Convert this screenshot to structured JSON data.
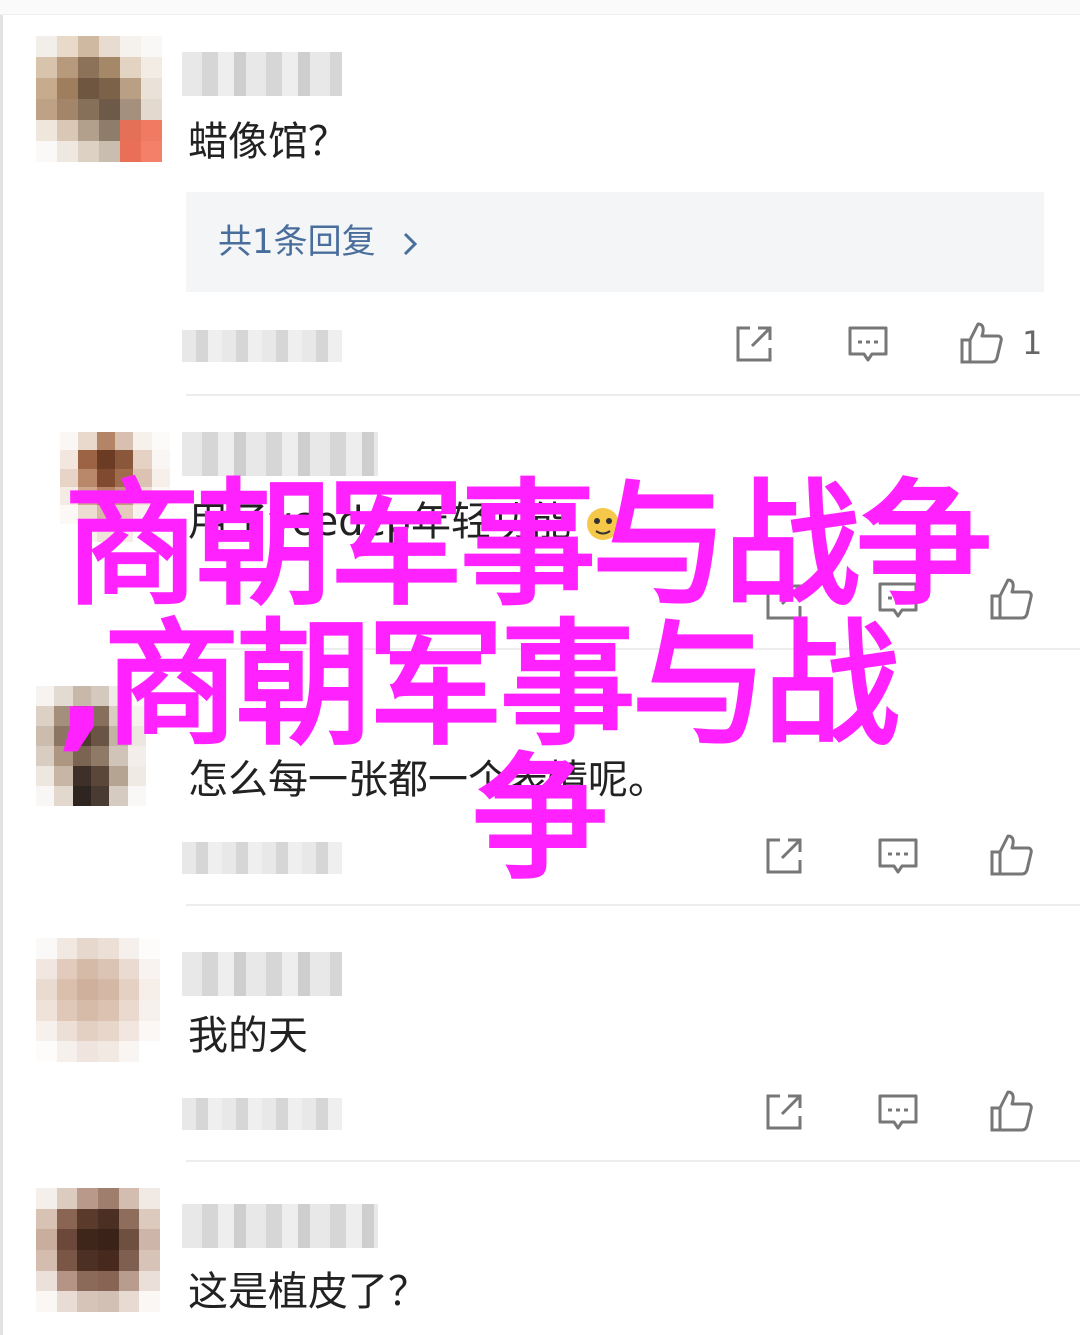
{
  "comments": [
    {
      "text": "蜡像馆？",
      "reply_link": "共1条回复",
      "like_count": "1"
    },
    {
      "text": "用了ycedcp年轻功能"
    },
    {
      "text": "怎么每一张都一个表情呢。"
    },
    {
      "text": "我的天"
    },
    {
      "text": "这是植皮了？"
    }
  ],
  "overlay": {
    "line1": "商朝军事与战争",
    "line2": ",商朝军事与战",
    "line3": "争"
  },
  "colors": {
    "overlay_text": "#ff22ff",
    "link": "#4a6e9c",
    "reply_bg": "#f4f5f7"
  },
  "icons": [
    "share-icon",
    "comment-icon",
    "like-icon",
    "chevron-right-icon",
    "emoji-icon"
  ]
}
